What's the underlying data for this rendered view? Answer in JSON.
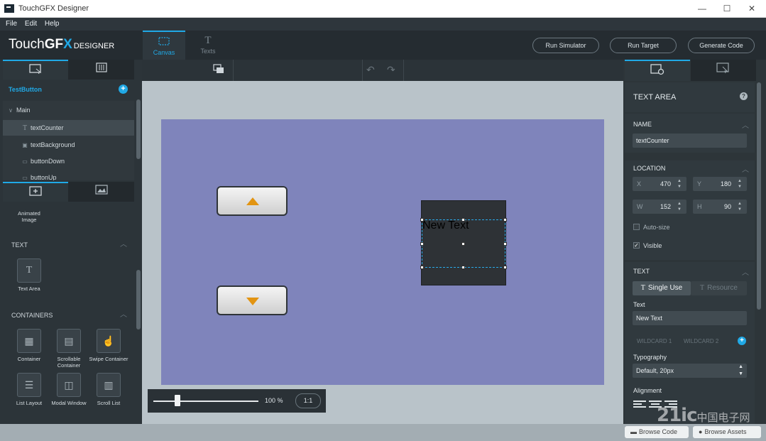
{
  "window": {
    "title": "TouchGFX Designer",
    "minimize": "—",
    "maximize": "☐",
    "close": "✕"
  },
  "menu": [
    "File",
    "Edit",
    "Help"
  ],
  "header": {
    "logo_touch": "Touch",
    "logo_gf": "GF",
    "logo_x": "X",
    "logo_designer": "DESIGNER",
    "tabs": [
      {
        "label": "Canvas",
        "icon": "canvas-icon"
      },
      {
        "label": "Texts",
        "icon": "texts-icon"
      }
    ],
    "buttons": [
      "Run Simulator",
      "Run Target",
      "Generate Code"
    ]
  },
  "left": {
    "screen_name": "TestButton",
    "tree": {
      "root": "Main",
      "items": [
        "textCounter",
        "textBackground",
        "buttonDown",
        "buttonUp"
      ]
    },
    "widget_partial": "Animated\nImage",
    "sections": [
      {
        "title": "TEXT",
        "widgets": [
          "Text Area"
        ]
      },
      {
        "title": "CONTAINERS",
        "widgets": [
          "Container",
          "Scrollable Container",
          "Swipe Container",
          "List Layout",
          "Modal Window",
          "Scroll List"
        ]
      }
    ]
  },
  "canvas": {
    "text_widget_value": "New Text",
    "zoom_percent": "100 %",
    "zoom_reset": "1:1",
    "zoom_level": 0.22,
    "colors": {
      "screen_bg": "#7f84bb",
      "button_arrow": "#e29412",
      "selection": "#2aa9e8"
    }
  },
  "right": {
    "section_title": "TEXT AREA",
    "help": "?",
    "name": {
      "label": "NAME",
      "value": "textCounter"
    },
    "location": {
      "label": "LOCATION",
      "x_label": "X",
      "x": "470",
      "y_label": "Y",
      "y": "180",
      "w_label": "W",
      "w": "152",
      "h_label": "H",
      "h": "90",
      "autosize": "Auto-size",
      "visible": "Visible",
      "visible_checked": true
    },
    "text": {
      "label": "TEXT",
      "single_use": "Single Use",
      "resource": "Resource",
      "text_label": "Text",
      "text_value": "New Text",
      "wildcard1": "WILDCARD 1",
      "wildcard2": "WILDCARD 2",
      "typography_label": "Typography",
      "typography_value": "Default, 20px",
      "alignment_label": "Alignment"
    }
  },
  "status": {
    "browse_code": "Browse Code",
    "other": "Browse Assets"
  },
  "watermark": {
    "main": "21ic",
    "cn": "中国电子网"
  },
  "accent_color": "#20a9e6"
}
